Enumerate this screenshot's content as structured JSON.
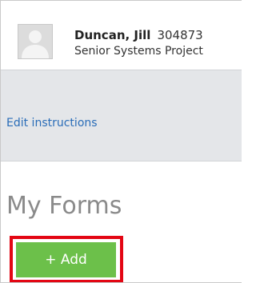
{
  "profile": {
    "name": "Duncan, Jill",
    "employee_id": "304873",
    "title": "Senior Systems Project",
    "avatar_icon": "user-silhouette-icon"
  },
  "links": {
    "edit_instructions": "Edit instructions"
  },
  "forms": {
    "heading": "My Forms",
    "add_button_label": "+ Add"
  },
  "colors": {
    "add_button": "#6cc04a",
    "highlight": "#e30613",
    "link": "#2a6db8",
    "band": "#e4e6e9"
  }
}
